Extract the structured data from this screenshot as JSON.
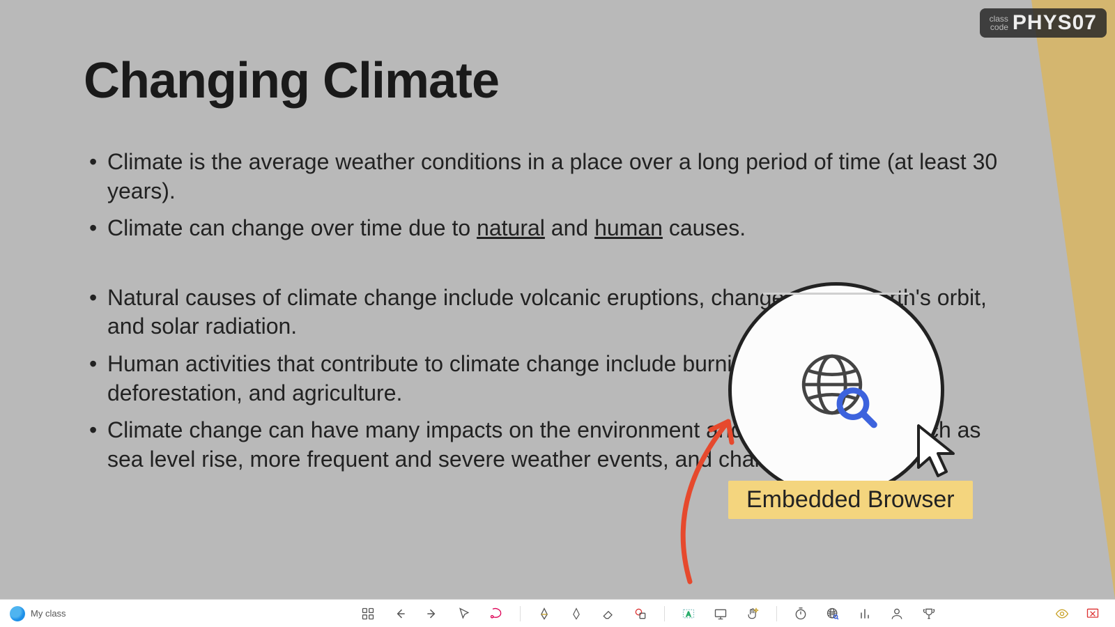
{
  "class_code": {
    "label1": "class",
    "label2": "code",
    "value": "PHYS07"
  },
  "slide": {
    "title": "Changing Climate",
    "bullets": [
      {
        "pre": "Climate is the average weather conditions in a place over a long period of time (at least 30 years)."
      },
      {
        "pre": "Climate can change over time due to ",
        "u1": "natural",
        "mid": " and ",
        "u2": "human",
        "post": " causes."
      },
      {
        "pre": "Natural causes of climate change include volcanic eruptions, changes in the Earth's orbit, and solar radiation."
      },
      {
        "pre": "Human activities that contribute to climate change include burning fossil fuels, deforestation, and agriculture."
      },
      {
        "pre": "Climate change can have many impacts on the environment and human society, such as sea level rise, more frequent and severe weather events, and changes in crop."
      }
    ]
  },
  "callout": {
    "tooltip": "Embedded Browser"
  },
  "toolbar": {
    "my_class": "My class",
    "icons": {
      "grid": "grid-icon",
      "back": "arrow-left-icon",
      "forward": "arrow-right-icon",
      "pointer": "pointer-icon",
      "lasso": "lasso-icon",
      "pen1": "pen-black-icon",
      "pen2": "pen-outline-icon",
      "eraser": "eraser-icon",
      "shapes": "shapes-icon",
      "text": "text-icon",
      "present": "present-icon",
      "hand": "hand-sparkle-icon",
      "timer": "timer-icon",
      "browser": "globe-search-icon",
      "poll": "poll-icon",
      "user": "user-icon",
      "trophy": "trophy-icon",
      "eye": "eye-icon",
      "exit": "exit-icon"
    }
  }
}
